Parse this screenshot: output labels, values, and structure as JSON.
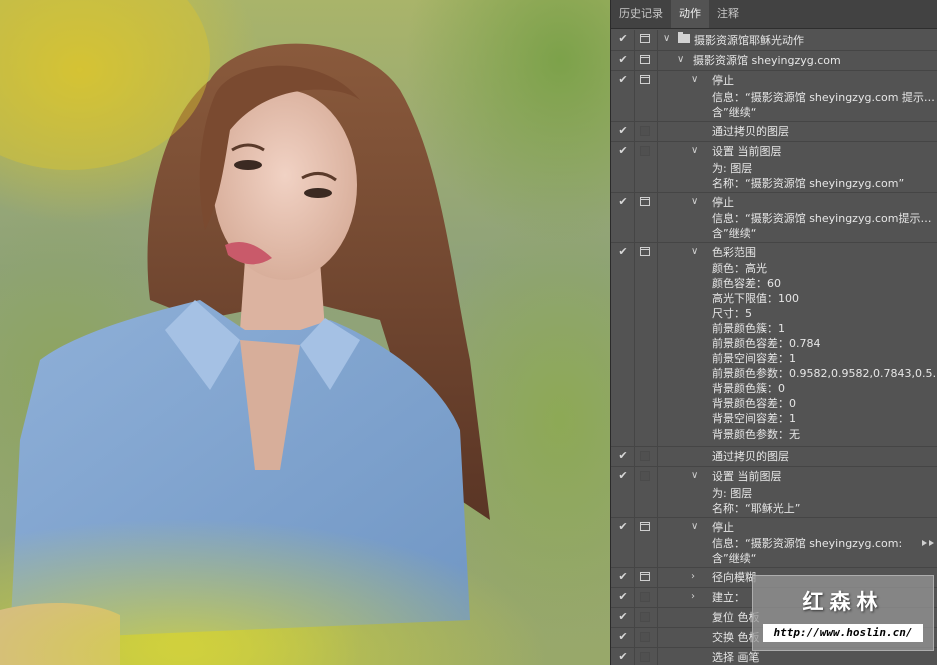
{
  "panel": {
    "tabs": [
      {
        "label": "历史记录",
        "active": false
      },
      {
        "label": "动作",
        "active": true
      },
      {
        "label": "注释",
        "active": false
      }
    ],
    "set_name": "摄影资源馆耶稣光动作",
    "action_name": "摄影资源馆 sheyingzyg.com",
    "steps": [
      {
        "title": "停止",
        "details": [
          "信息：“摄影资源馆 sheyingzyg.com 提示…",
          "含”继续“"
        ]
      },
      {
        "title": "通过拷贝的图层",
        "details": []
      },
      {
        "title": "设置 当前图层",
        "details": [
          "为: 图层",
          "名称：“摄影资源馆 sheyingzyg.com”"
        ]
      },
      {
        "title": "停止",
        "details": [
          "信息：“摄影资源馆 sheyingzyg.com提示…",
          "含”继续“"
        ]
      },
      {
        "title": "色彩范围",
        "details": [
          "颜色：高光",
          "颜色容差：60",
          "高光下限值：100",
          "尺寸：5",
          "前景颜色簇：1",
          "前景颜色容差：0.784",
          "前景空间容差：1",
          "前景颜色参数：0.9582,0.9582,0.7843,0.5…",
          "背景颜色簇：0",
          "背景颜色容差：0",
          "背景空间容差：1",
          "背景颜色参数：无"
        ]
      },
      {
        "title": "通过拷贝的图层",
        "details": []
      },
      {
        "title": "设置 当前图层",
        "details": [
          "为: 图层",
          "名称：“耶稣光上”"
        ]
      },
      {
        "title": "停止",
        "details": [
          "信息：“摄影资源馆 sheyingzyg.com:",
          "含”继续“"
        ]
      },
      {
        "title": "径向模糊",
        "details": []
      },
      {
        "title": "建立：",
        "details": []
      },
      {
        "title": "复位 色板",
        "details": []
      },
      {
        "title": "交换 色板",
        "details": []
      },
      {
        "title": "选择 画笔",
        "details": []
      }
    ]
  },
  "watermark": {
    "title": "红森林",
    "url": "http://www.hoslin.cn/"
  },
  "colors": {
    "panel_bg": "#535353",
    "tab_bar_bg": "#424242",
    "text": "#e6e6e6"
  },
  "icons": [
    "check-icon",
    "dialog-toggle-icon",
    "chevron-down-icon",
    "chevron-right-icon",
    "folder-icon"
  ]
}
